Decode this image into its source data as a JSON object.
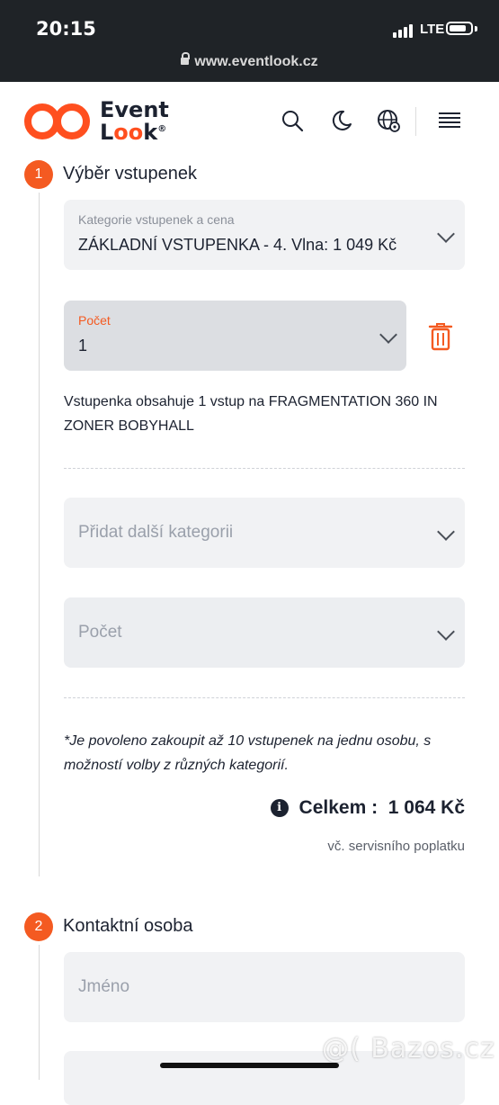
{
  "status_bar": {
    "time": "20:15",
    "network": "LTE",
    "url": "www.eventlook.cz"
  },
  "header": {
    "logo_line1": "Event",
    "logo_line2_a": "L",
    "logo_line2_oo": "oo",
    "logo_line2_b": "k",
    "registered": "®"
  },
  "step1": {
    "number": "1",
    "title": "Výběr vstupenek",
    "category_label": "Kategorie vstupenek a cena",
    "category_value": "ZÁKLADNÍ VSTUPENKA - 4. Vlna: 1 049 Kč",
    "count_label": "Počet",
    "count_value": "1",
    "description": "Vstupenka obsahuje 1 vstup na FRAGMENTATION 360 IN ZONER BOBYHALL",
    "add_category_placeholder": "Přidat další kategorii",
    "count2_placeholder": "Počet",
    "note": "*Je povoleno zakoupit až 10 vstupenek na jednu osobu, s možností volby z různých kategorií.",
    "total_label": "Celkem :",
    "total_value": "1 064 Kč",
    "fee_note": "vč. servisního poplatku"
  },
  "step2": {
    "number": "2",
    "title": "Kontaktní osoba",
    "name_placeholder": "Jméno"
  },
  "watermark": "@( Bazos.cz",
  "colors": {
    "accent": "#f45a21",
    "dark": "#1c2230",
    "field_bg": "#f1f2f4",
    "field_active_bg": "#dcdee2"
  },
  "icons": [
    "lock-icon",
    "search-icon",
    "moon-icon",
    "globe-settings-icon",
    "menu-icon",
    "chevron-down-icon",
    "trash-icon",
    "info-icon"
  ]
}
